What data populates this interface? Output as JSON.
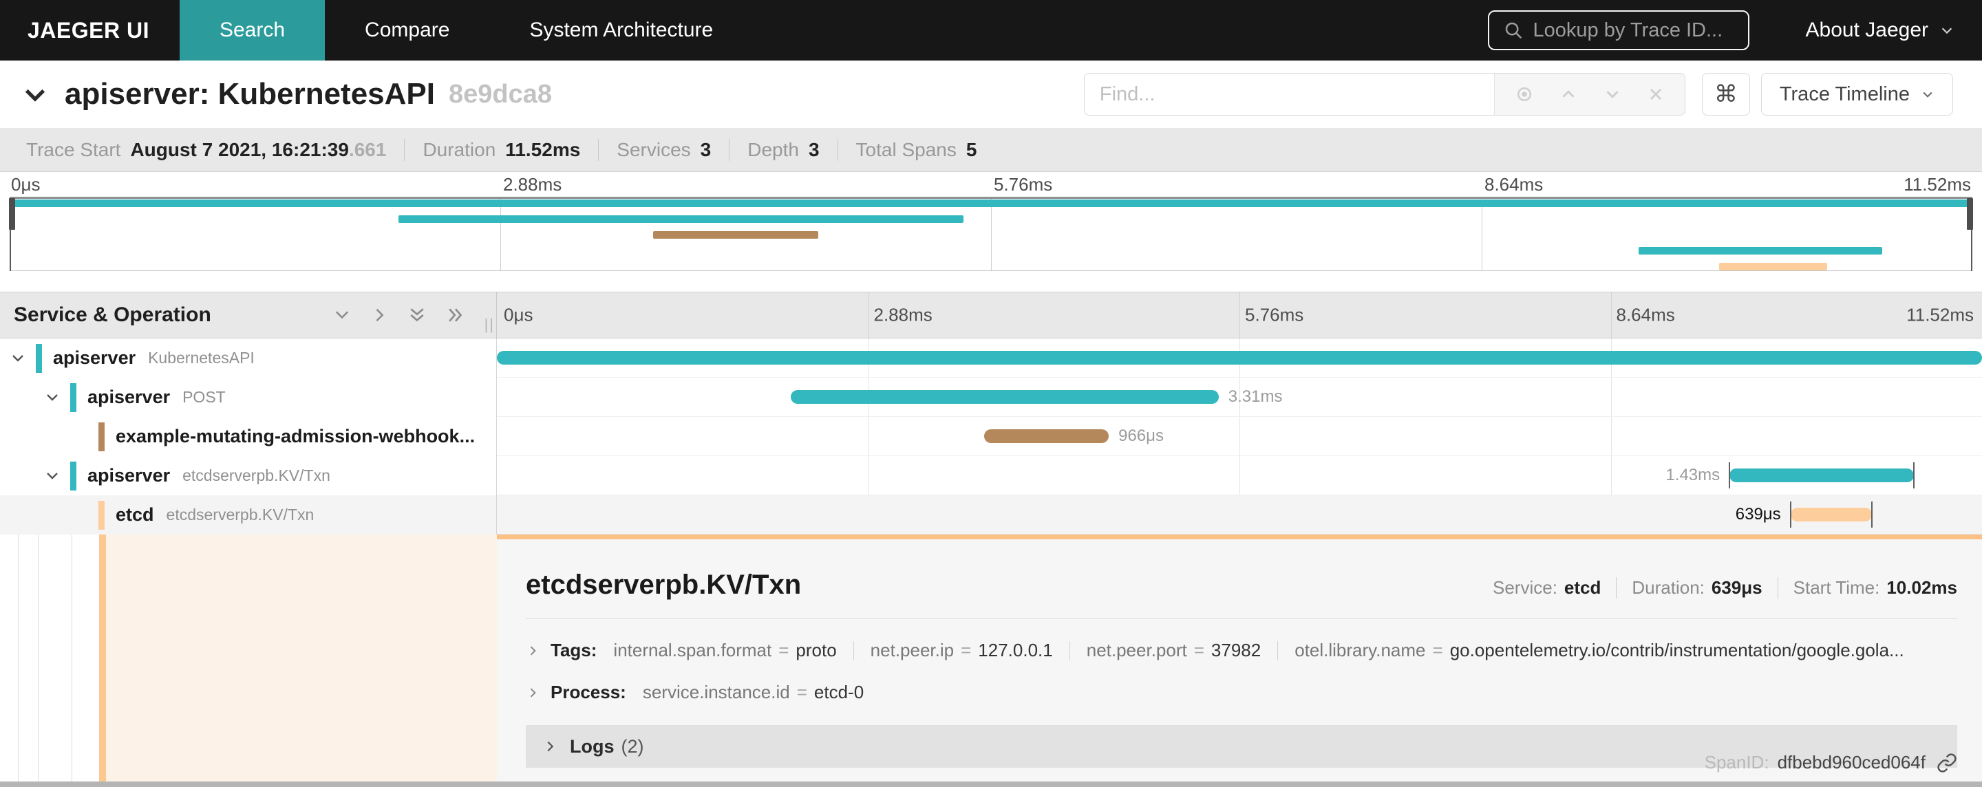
{
  "colors": {
    "teal": "#32b8be",
    "brown": "#b5885c",
    "orange": "#fdcd9b",
    "nav_active": "#2b9b9c",
    "selected_accent": "#fac084"
  },
  "nav": {
    "brand": "JAEGER UI",
    "items": [
      {
        "label": "Search",
        "active": true
      },
      {
        "label": "Compare"
      },
      {
        "label": "System Architecture"
      }
    ],
    "lookup_placeholder": "Lookup by Trace ID...",
    "about_label": "About Jaeger"
  },
  "trace_header": {
    "title": "apiserver: KubernetesAPI",
    "trace_id_short": "8e9dca8",
    "find_placeholder": "Find...",
    "command_key": "⌘",
    "view_selector": "Trace Timeline"
  },
  "stats": {
    "trace_start_label": "Trace Start",
    "trace_start_value": "August 7 2021, 16:21:39",
    "trace_start_fraction": ".661",
    "duration_label": "Duration",
    "duration_value": "11.52ms",
    "services_label": "Services",
    "services_value": "3",
    "depth_label": "Depth",
    "depth_value": "3",
    "total_spans_label": "Total Spans",
    "total_spans_value": "5"
  },
  "ticks": {
    "t0": "0μs",
    "t1": "2.88ms",
    "t2": "5.76ms",
    "t3": "8.64ms",
    "t4": "11.52ms"
  },
  "minimap": {
    "bars": [
      {
        "color": "teal",
        "start": 0,
        "width": 100
      },
      {
        "color": "teal",
        "start": 19.8,
        "width": 28.8
      },
      {
        "color": "brown",
        "start": 32.8,
        "width": 8.4
      },
      {
        "color": "teal",
        "start": 83.0,
        "width": 12.4
      },
      {
        "color": "orange",
        "start": 87.1,
        "width": 5.5
      }
    ]
  },
  "timeline": {
    "left_header": "Service & Operation",
    "spans": [
      {
        "service": "apiserver",
        "operation": "KubernetesAPI",
        "depth": 0,
        "color": "teal",
        "start_pct": 0,
        "width_pct": 100,
        "duration_label": "",
        "label_side": "none"
      },
      {
        "service": "apiserver",
        "operation": "POST",
        "depth": 1,
        "color": "teal",
        "start_pct": 19.8,
        "width_pct": 28.8,
        "duration_label": "3.31ms",
        "label_side": "right"
      },
      {
        "service": "example-mutating-admission-webhook...",
        "operation": "",
        "depth": 2,
        "color": "brown",
        "start_pct": 32.8,
        "width_pct": 8.4,
        "duration_label": "966μs",
        "label_side": "right"
      },
      {
        "service": "apiserver",
        "operation": "etcdserverpb.KV/Txn",
        "depth": 1,
        "color": "teal",
        "start_pct": 83.0,
        "width_pct": 12.4,
        "duration_label": "1.43ms",
        "label_side": "left",
        "edge_ticks": true
      },
      {
        "service": "etcd",
        "operation": "etcdserverpb.KV/Txn",
        "depth": 2,
        "color": "orange",
        "start_pct": 87.1,
        "width_pct": 5.5,
        "duration_label": "639μs",
        "label_side": "left",
        "edge_ticks": true,
        "label_dark": true,
        "selected": true
      }
    ]
  },
  "detail": {
    "operation": "etcdserverpb.KV/Txn",
    "meta": [
      {
        "label": "Service:",
        "value": "etcd"
      },
      {
        "label": "Duration:",
        "value": "639μs"
      },
      {
        "label": "Start Time:",
        "value": "10.02ms"
      }
    ],
    "tags_label": "Tags:",
    "tags": [
      {
        "key": "internal.span.format",
        "value": "proto"
      },
      {
        "key": "net.peer.ip",
        "value": "127.0.0.1"
      },
      {
        "key": "net.peer.port",
        "value": "37982"
      },
      {
        "key": "otel.library.name",
        "value": "go.opentelemetry.io/contrib/instrumentation/google.gola..."
      }
    ],
    "process_label": "Process:",
    "process": [
      {
        "key": "service.instance.id",
        "value": "etcd-0"
      }
    ],
    "logs_label": "Logs",
    "logs_count": "(2)",
    "spanid_label": "SpanID:",
    "span_id": "dfbebd960ced064f"
  }
}
